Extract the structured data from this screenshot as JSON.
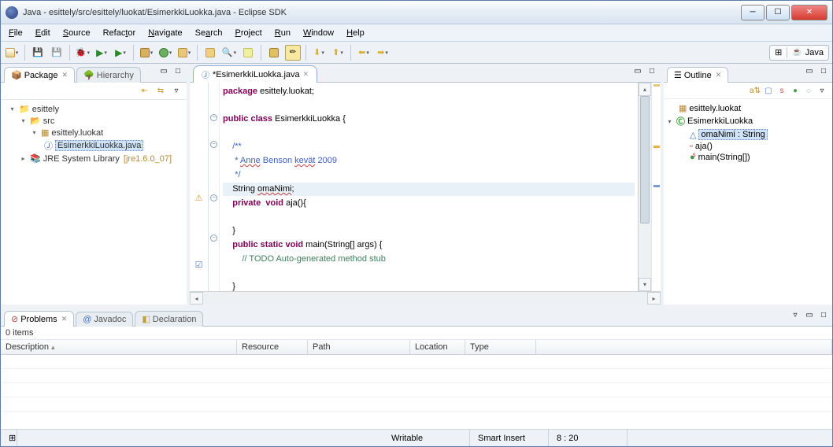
{
  "window": {
    "title": "Java - esittely/src/esittely/luokat/EsimerkkiLuokka.java - Eclipse SDK"
  },
  "menu": [
    "File",
    "Edit",
    "Source",
    "Refactor",
    "Navigate",
    "Search",
    "Project",
    "Run",
    "Window",
    "Help"
  ],
  "perspective": {
    "label": "Java"
  },
  "package_view": {
    "tab_label": "Package",
    "hierarchy_tab": "Hierarchy",
    "tree": {
      "project": "esittely",
      "src": "src",
      "pkg": "esittely.luokat",
      "file": "EsimerkkiLuokka.java",
      "jre": "JRE System Library",
      "jre_version": "[jre1.6.0_07]"
    }
  },
  "editor": {
    "tab_label": "*EsimerkkiLuokka.java",
    "code": {
      "l1a": "package",
      "l1b": " esittely.luokat;",
      "l3a": "public",
      "l3b": " class",
      "l3c": " EsimerkkiLuokka {",
      "l5": "    /**",
      "l6a": "     * ",
      "l6b": "Anne",
      "l6c": " Benson ",
      "l6d": "kevät",
      "l6e": " 2009",
      "l7": "     */",
      "l8a": "    String ",
      "l8b": "omaNimi",
      "l8c": ";",
      "l9a": "    private",
      "l9b": "  void",
      "l9c": " aja(){",
      "l11": "    }",
      "l12a": "    public",
      "l12b": " static",
      "l12c": " void",
      "l12d": " main(String[] args) {",
      "l13": "        // TODO Auto-generated method stub",
      "l15": "    }"
    }
  },
  "outline": {
    "tab_label": "Outline",
    "items": {
      "pkg": "esittely.luokat",
      "cls": "EsimerkkiLuokka",
      "field": "omaNimi : String",
      "m1": "aja()",
      "m2": "main(String[])"
    }
  },
  "problems": {
    "tab_label": "Problems",
    "javadoc_tab": "Javadoc",
    "decl_tab": "Declaration",
    "items_count": "0 items",
    "columns": [
      "Description",
      "Resource",
      "Path",
      "Location",
      "Type"
    ]
  },
  "status": {
    "writable": "Writable",
    "insert": "Smart Insert",
    "pos": "8 : 20"
  }
}
